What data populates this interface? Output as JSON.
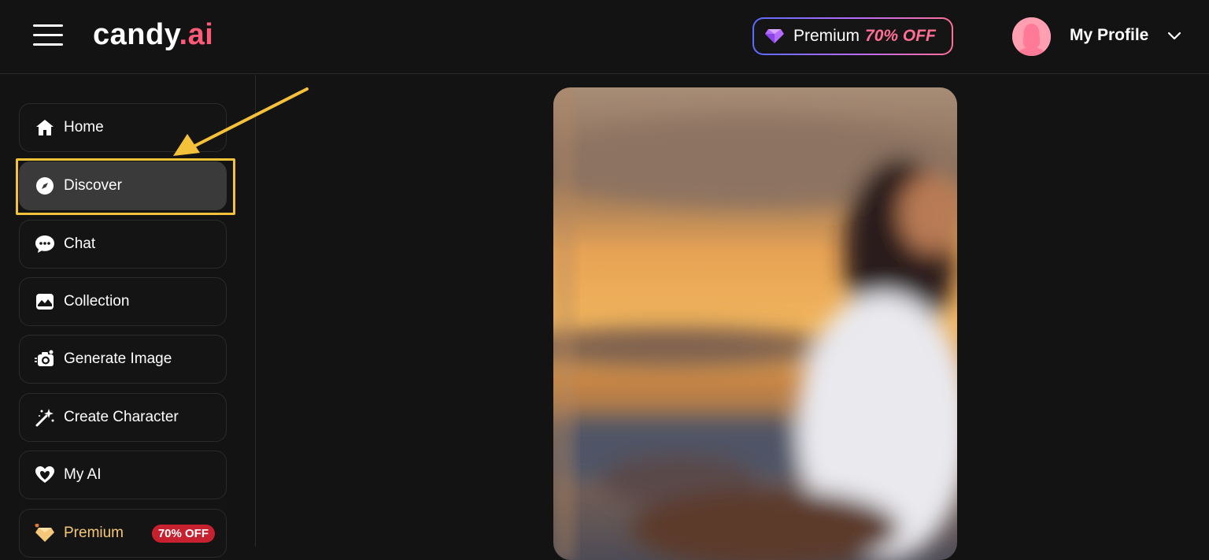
{
  "header": {
    "logo_main": "candy",
    "logo_accent": ".ai",
    "premium_label": "Premium",
    "premium_discount": "70% OFF",
    "profile_label": "My Profile",
    "menu_icon": "hamburger-icon",
    "gem_icon": "diamond-icon",
    "chevron_icon": "chevron-down-icon"
  },
  "sidebar": {
    "items": [
      {
        "label": "Home",
        "icon": "home-icon"
      },
      {
        "label": "Discover",
        "icon": "compass-icon",
        "active": true
      },
      {
        "label": "Chat",
        "icon": "chat-icon"
      },
      {
        "label": "Collection",
        "icon": "image-icon"
      },
      {
        "label": "Generate Image",
        "icon": "camera-icon"
      },
      {
        "label": "Create Character",
        "icon": "magic-wand-icon"
      },
      {
        "label": "My AI",
        "icon": "heart-icon"
      },
      {
        "label": "Premium",
        "icon": "diamond-icon",
        "badge": "70% OFF"
      }
    ]
  },
  "colors": {
    "background": "#131313",
    "accent_pink": "#ff5a78",
    "highlight_yellow": "#f4c13b",
    "badge_red": "#c7202f"
  }
}
